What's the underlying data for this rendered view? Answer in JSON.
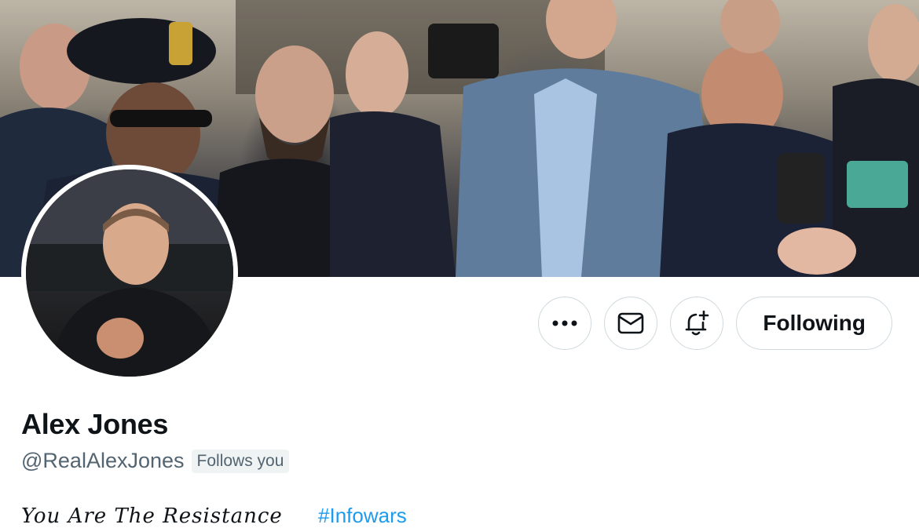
{
  "profile": {
    "name": "Alex Jones",
    "handle": "@RealAlexJones",
    "follows_you_label": "Follows you",
    "bio_text": "You Are The Resistance",
    "bio_hashtag": "#Infowars"
  },
  "actions": {
    "more_icon": "more-horizontal-icon",
    "message_icon": "envelope-icon",
    "notify_icon": "bell-plus-icon",
    "follow_label": "Following"
  },
  "colors": {
    "text": "#0f1419",
    "secondary_text": "#536471",
    "link": "#1d9bf0",
    "border": "#cfd9de",
    "badge_bg": "#eff3f4"
  }
}
